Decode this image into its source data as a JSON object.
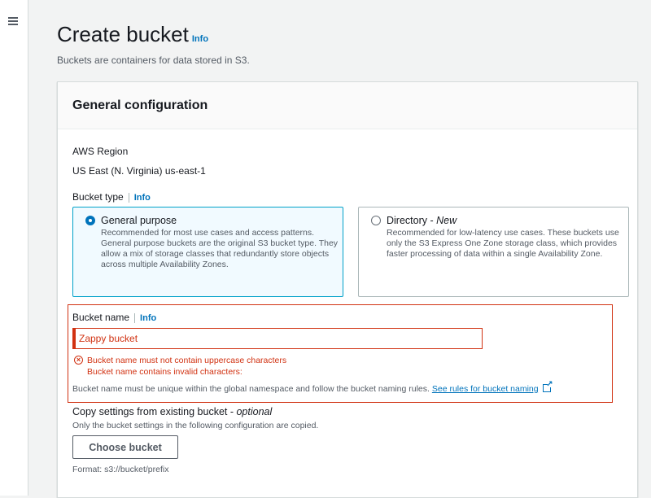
{
  "nav": {
    "menu_icon": "hamburger-icon"
  },
  "header": {
    "title": "Create bucket",
    "info": "Info",
    "subtitle": "Buckets are containers for data stored in S3."
  },
  "panel": {
    "title": "General configuration"
  },
  "region": {
    "label": "AWS Region",
    "value": "US East (N. Virginia) us-east-1"
  },
  "bucket_type": {
    "label": "Bucket type",
    "info": "Info",
    "options": [
      {
        "title": "General purpose",
        "description": "Recommended for most use cases and access patterns. General purpose buckets are the original S3 bucket type. They allow a mix of storage classes that redundantly store objects across multiple Availability Zones.",
        "selected": true
      },
      {
        "title": "Directory",
        "title_suffix": "New",
        "description": "Recommended for low-latency use cases. These buckets use only the S3 Express One Zone storage class, which provides faster processing of data within a single Availability Zone.",
        "selected": false
      }
    ]
  },
  "bucket_name": {
    "label": "Bucket name",
    "info": "Info",
    "value": "Zappy bucket",
    "errors": [
      "Bucket name must not contain uppercase characters",
      "Bucket name contains invalid characters:"
    ],
    "hint": "Bucket name must be unique within the global namespace and follow the bucket naming rules.",
    "rules_link": "See rules for bucket naming"
  },
  "copy_settings": {
    "label": "Copy settings from existing bucket",
    "optional": "optional",
    "description": "Only the bucket settings in the following configuration are copied.",
    "button": "Choose bucket",
    "format": "Format: s3://bucket/prefix"
  },
  "colors": {
    "accent": "#0073bb",
    "error": "#d13212",
    "selected_border": "#00a1c9"
  }
}
